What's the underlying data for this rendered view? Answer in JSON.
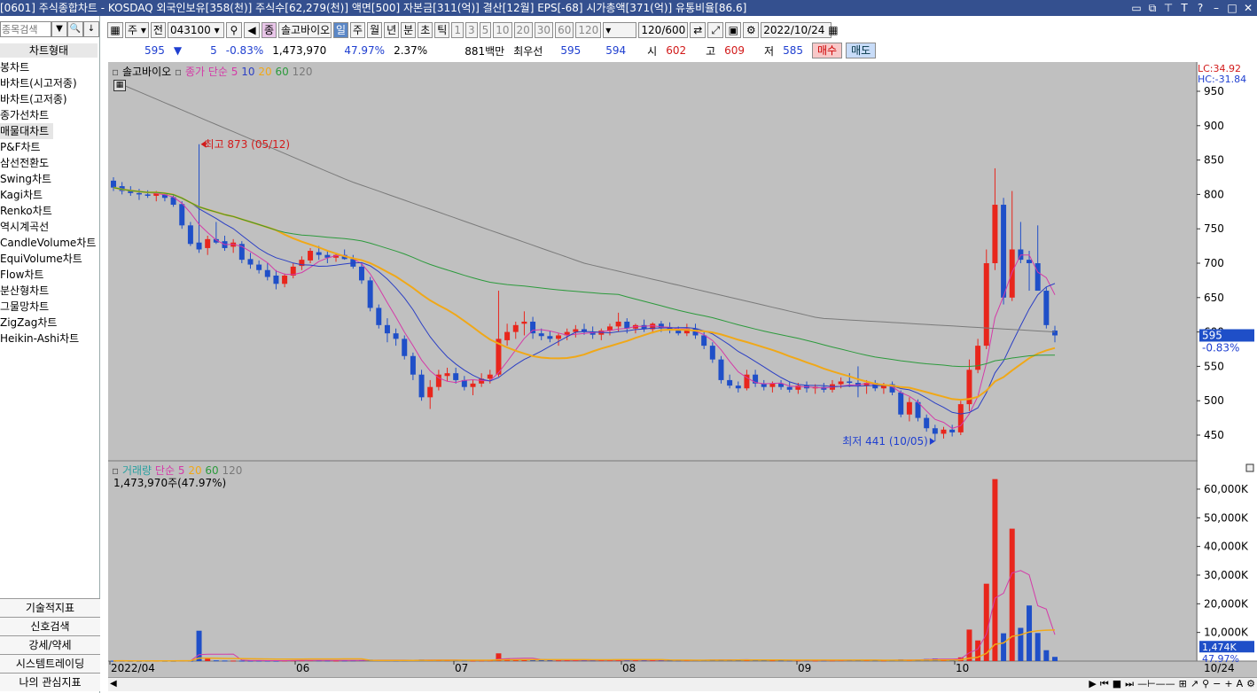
{
  "window": {
    "title": "[0601] 주식종합차트 - KOSDAQ 외국인보유[358(천)] 주식수[62,279(천)] 액면[500] 자본금[311(억)] 결산[12월] EPS[-68] 시가총액[371(억)] 유통비율[86.6]"
  },
  "sidebar": {
    "search_placeholder": "종목검색",
    "header": "차트형태",
    "items": [
      "봉차트",
      "바차트(시고저종)",
      "바차트(고저종)",
      "종가선차트",
      "매물대차트",
      "P&F차트",
      "삼선전환도",
      "Swing차트",
      "Kagi차트",
      "Renko차트",
      "역시계곡선",
      "CandleVolume차트",
      "EquiVolume차트",
      "Flow차트",
      "분산형차트",
      "그물망차트",
      "ZigZag차트",
      "Heikin-Ashi차트"
    ],
    "selected_index": 4,
    "bottom": [
      "기술적지표",
      "신호검색",
      "강세/약세",
      "시스템트레이딩",
      "나의 관심지표"
    ]
  },
  "toolbar": {
    "period_unit": "주",
    "prev_label": "전",
    "code": "043100",
    "name_badge": "종",
    "name": "솔고바이오",
    "periods": [
      "일",
      "주",
      "월",
      "년",
      "분",
      "초",
      "틱"
    ],
    "active_period": "일",
    "minutes": [
      "1",
      "3",
      "5",
      "10",
      "20",
      "30",
      "60",
      "120"
    ],
    "count": "120",
    "count_total": "/600",
    "date": "2022/10/24"
  },
  "quote": {
    "price": "595",
    "change_arrow": "▼",
    "change": "5",
    "change_pct": "-0.83%",
    "volume": "1,473,970",
    "vol_ratio": "47.97%",
    "turnover": "2.37%",
    "amount": "881백만",
    "best_label": "최우선",
    "best_ask": "595",
    "best_bid": "594",
    "open_label": "시",
    "open": "602",
    "high_label": "고",
    "high": "609",
    "low_label": "저",
    "low": "585",
    "buy": "매수",
    "sell": "매도"
  },
  "price_panel": {
    "legend_name": "솔고바이오",
    "legend_ma": "종가 단순",
    "ma_periods": [
      "5",
      "10",
      "20",
      "60",
      "120"
    ],
    "lc": "LC:34.92",
    "hc": "HC:-31.84",
    "y_ticks": [
      "950",
      "900",
      "850",
      "800",
      "750",
      "700",
      "650",
      "600",
      "550",
      "500",
      "450"
    ],
    "current_price": "595",
    "current_pct": "-0.83%",
    "high_marker": "최고 873 (05/12)",
    "low_marker": "최저 441 (10/05)"
  },
  "volume_panel": {
    "legend_name": "거래량",
    "legend_ma": "단순",
    "ma_periods": [
      "5",
      "20",
      "60",
      "120"
    ],
    "info": "1,473,970주(47.97%)",
    "y_ticks": [
      "60,000K",
      "50,000K",
      "40,000K",
      "30,000K",
      "20,000K",
      "10,000K"
    ],
    "current_vol": "1,474K",
    "current_pct": "47.97%"
  },
  "x_axis": {
    "labels": [
      "2022/04",
      "06",
      "07",
      "08",
      "09",
      "10"
    ],
    "end_label": "10/24"
  },
  "colors": {
    "up": "#e8261c",
    "down": "#1f4fc8",
    "ma5": "#d43aa8",
    "ma10": "#2b3fc4",
    "ma20": "#f0a818",
    "ma60": "#2c9a3c",
    "ma120": "#7a7a7a",
    "background": "#c0c0c0"
  },
  "chart_data": {
    "type": "candlestick",
    "x_start": "2022-04",
    "x_end": "2022-10-24",
    "ylim": [
      420,
      980
    ],
    "candles": [
      [
        820,
        825,
        805,
        810
      ],
      [
        812,
        818,
        800,
        805
      ],
      [
        806,
        812,
        798,
        802
      ],
      [
        802,
        808,
        792,
        800
      ],
      [
        800,
        806,
        795,
        798
      ],
      [
        798,
        805,
        790,
        803
      ],
      [
        800,
        802,
        790,
        795
      ],
      [
        796,
        800,
        782,
        785
      ],
      [
        786,
        790,
        750,
        755
      ],
      [
        755,
        760,
        725,
        728
      ],
      [
        730,
        873,
        715,
        720
      ],
      [
        722,
        740,
        712,
        735
      ],
      [
        735,
        760,
        728,
        730
      ],
      [
        732,
        740,
        718,
        722
      ],
      [
        724,
        735,
        715,
        730
      ],
      [
        728,
        732,
        700,
        705
      ],
      [
        706,
        715,
        692,
        698
      ],
      [
        698,
        704,
        685,
        690
      ],
      [
        690,
        700,
        675,
        680
      ],
      [
        682,
        690,
        662,
        670
      ],
      [
        670,
        685,
        665,
        682
      ],
      [
        682,
        700,
        678,
        695
      ],
      [
        696,
        710,
        690,
        705
      ],
      [
        704,
        722,
        700,
        718
      ],
      [
        716,
        725,
        705,
        712
      ],
      [
        712,
        718,
        700,
        708
      ],
      [
        708,
        715,
        702,
        712
      ],
      [
        712,
        720,
        705,
        706
      ],
      [
        706,
        712,
        692,
        695
      ],
      [
        695,
        700,
        670,
        675
      ],
      [
        675,
        680,
        630,
        635
      ],
      [
        635,
        640,
        605,
        610
      ],
      [
        610,
        620,
        585,
        598
      ],
      [
        598,
        605,
        580,
        590
      ],
      [
        590,
        595,
        560,
        565
      ],
      [
        565,
        570,
        530,
        538
      ],
      [
        538,
        545,
        500,
        505
      ],
      [
        505,
        530,
        488,
        520
      ],
      [
        520,
        545,
        515,
        538
      ],
      [
        536,
        548,
        528,
        540
      ],
      [
        540,
        548,
        525,
        530
      ],
      [
        530,
        536,
        515,
        520
      ],
      [
        520,
        530,
        508,
        525
      ],
      [
        525,
        540,
        520,
        532
      ],
      [
        532,
        545,
        525,
        538
      ],
      [
        538,
        660,
        535,
        590
      ],
      [
        588,
        612,
        580,
        600
      ],
      [
        600,
        615,
        590,
        610
      ],
      [
        612,
        630,
        595,
        615
      ],
      [
        615,
        622,
        590,
        598
      ],
      [
        598,
        605,
        588,
        594
      ],
      [
        594,
        602,
        585,
        590
      ],
      [
        590,
        598,
        580,
        595
      ],
      [
        595,
        605,
        588,
        600
      ],
      [
        600,
        610,
        592,
        604
      ],
      [
        604,
        612,
        596,
        600
      ],
      [
        600,
        608,
        590,
        596
      ],
      [
        596,
        605,
        588,
        602
      ],
      [
        602,
        612,
        595,
        608
      ],
      [
        608,
        628,
        600,
        615
      ],
      [
        615,
        620,
        598,
        605
      ],
      [
        605,
        612,
        598,
        610
      ],
      [
        610,
        618,
        600,
        604
      ],
      [
        604,
        614,
        598,
        612
      ],
      [
        612,
        616,
        600,
        606
      ],
      [
        606,
        614,
        598,
        602
      ],
      [
        602,
        608,
        595,
        598
      ],
      [
        598,
        612,
        594,
        605
      ],
      [
        605,
        612,
        590,
        595
      ],
      [
        595,
        600,
        575,
        580
      ],
      [
        580,
        585,
        555,
        560
      ],
      [
        560,
        565,
        525,
        530
      ],
      [
        530,
        538,
        518,
        522
      ],
      [
        522,
        528,
        512,
        518
      ],
      [
        518,
        545,
        515,
        538
      ],
      [
        538,
        545,
        520,
        525
      ],
      [
        525,
        530,
        515,
        520
      ],
      [
        520,
        528,
        512,
        525
      ],
      [
        525,
        530,
        516,
        520
      ],
      [
        520,
        528,
        512,
        516
      ],
      [
        516,
        526,
        510,
        522
      ],
      [
        522,
        528,
        512,
        518
      ],
      [
        518,
        524,
        510,
        520
      ],
      [
        520,
        526,
        512,
        516
      ],
      [
        516,
        530,
        512,
        524
      ],
      [
        524,
        534,
        518,
        528
      ],
      [
        528,
        540,
        520,
        526
      ],
      [
        526,
        550,
        505,
        522
      ],
      [
        522,
        530,
        510,
        526
      ],
      [
        526,
        530,
        514,
        518
      ],
      [
        518,
        526,
        510,
        524
      ],
      [
        524,
        528,
        508,
        512
      ],
      [
        512,
        515,
        476,
        480
      ],
      [
        480,
        505,
        470,
        498
      ],
      [
        498,
        502,
        470,
        475
      ],
      [
        475,
        480,
        455,
        460
      ],
      [
        460,
        465,
        441,
        452
      ],
      [
        452,
        462,
        445,
        458
      ],
      [
        458,
        465,
        448,
        454
      ],
      [
        454,
        500,
        450,
        495
      ],
      [
        495,
        560,
        485,
        545
      ],
      [
        545,
        590,
        540,
        580
      ],
      [
        580,
        720,
        575,
        700
      ],
      [
        700,
        838,
        690,
        785
      ],
      [
        785,
        795,
        640,
        650
      ],
      [
        650,
        805,
        645,
        720
      ],
      [
        720,
        760,
        700,
        705
      ],
      [
        705,
        718,
        660,
        700
      ],
      [
        700,
        755,
        690,
        660
      ],
      [
        660,
        665,
        605,
        610
      ],
      [
        602,
        609,
        585,
        595
      ]
    ],
    "volume_k": [
      100,
      120,
      90,
      80,
      110,
      130,
      100,
      95,
      160,
      140,
      10600,
      900,
      260,
      200,
      180,
      160,
      150,
      170,
      160,
      140,
      220,
      260,
      280,
      300,
      250,
      220,
      200,
      230,
      260,
      320,
      500,
      380,
      300,
      260,
      280,
      320,
      520,
      400,
      320,
      300,
      280,
      220,
      200,
      240,
      260,
      2700,
      900,
      600,
      520,
      420,
      360,
      300,
      280,
      300,
      320,
      300,
      280,
      320,
      380,
      420,
      360,
      300,
      300,
      320,
      300,
      280,
      260,
      300,
      320,
      400,
      520,
      600,
      460,
      380,
      440,
      360,
      300,
      280,
      260,
      240,
      260,
      240,
      220,
      240,
      260,
      300,
      340,
      420,
      320,
      280,
      260,
      300,
      620,
      480,
      540,
      720,
      900,
      700,
      620,
      1300,
      11000,
      7200,
      27000,
      63500,
      9700,
      46200,
      11600,
      19400,
      9800,
      3800,
      1474
    ]
  }
}
